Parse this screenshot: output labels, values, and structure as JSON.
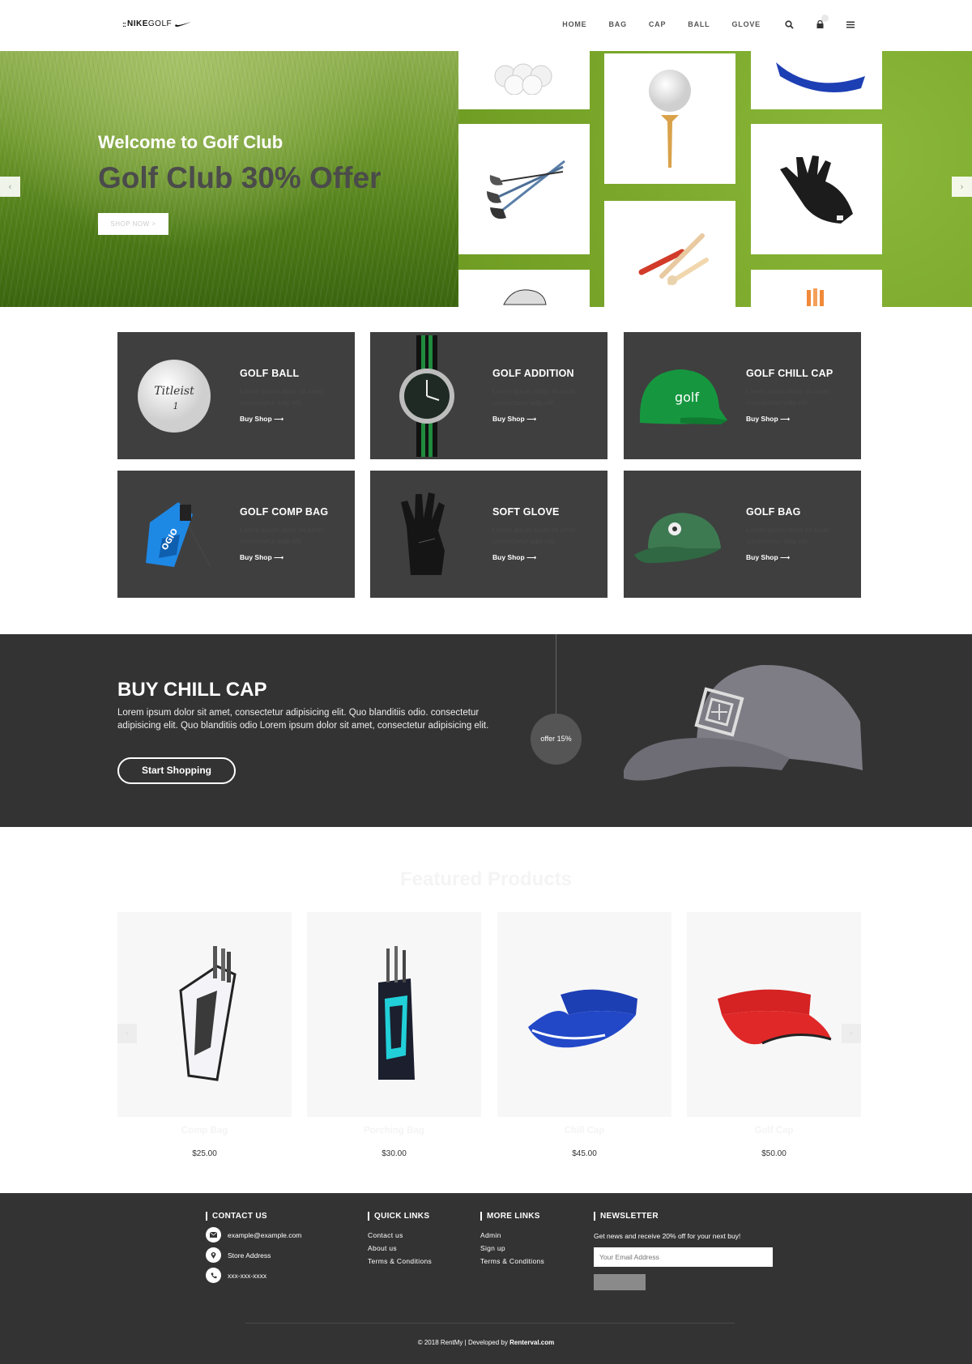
{
  "header": {
    "logo_prefix": "::",
    "logo_brand": "NIKE",
    "logo_suffix": "GOLF",
    "nav": [
      "HOME",
      "BAG",
      "CAP",
      "BALL",
      "GLOVE"
    ],
    "icons": [
      "search-icon",
      "cart-icon",
      "menu-icon"
    ]
  },
  "hero": {
    "subtitle": "Welcome to Golf Club",
    "title": "Golf Club 30% Offer",
    "button": "SHOP NOW  >",
    "prev_arrow": "‹",
    "next_arrow": "›"
  },
  "categories": [
    {
      "title": "GOLF BALL",
      "desc": "Lorem ipsum dolor sit amet, consectetur adip elit.",
      "link": "Buy Shop ⟶"
    },
    {
      "title": "GOLF ADDITION",
      "desc": "Lorem ipsum dolor sit amet, consectetur adip elit.",
      "link": "Buy Shop ⟶"
    },
    {
      "title": "GOLF CHILL CAP",
      "desc": "Lorem ipsum dolor sit amet, consectetur adip elit.",
      "link": "Buy Shop ⟶"
    },
    {
      "title": "GOLF COMP BAG",
      "desc": "Lorem ipsum dolor sit amet, consectetur adip elit.",
      "link": "Buy Shop ⟶"
    },
    {
      "title": "SOFT GLOVE",
      "desc": "Lorem ipsum dolor sit amet, consectetur adip elit.",
      "link": "Buy Shop ⟶"
    },
    {
      "title": "GOLF BAG",
      "desc": "Lorem ipsum dolor sit amet, consectetur adip elit.",
      "link": "Buy Shop ⟶"
    }
  ],
  "category_images": {
    "ball_text": "Titleist",
    "ball_number": "1",
    "cap_text": "golf",
    "bag_text": "OGIO"
  },
  "promo": {
    "title": "BUY CHILL CAP",
    "text": "Lorem ipsum dolor sit amet, consectetur adipisicing elit. Quo blanditiis odio. consectetur adipisicing elit. Quo blanditiis odio Lorem ipsum dolor sit amet, consectetur adipisicing elit.",
    "button": "Start Shopping",
    "offer": "offer 15%"
  },
  "featured": {
    "title": "Featured Products",
    "products": [
      {
        "name": "Comp Bag",
        "price": "$25.00"
      },
      {
        "name": "Porching Bag",
        "price": "$30.00"
      },
      {
        "name": "Chill Cap",
        "price": "$45.00"
      },
      {
        "name": "Golf Cap",
        "price": "$50.00"
      }
    ],
    "prev_arrow": "‹",
    "next_arrow": "›"
  },
  "footer": {
    "contact_title": "CONTACT US",
    "contact": [
      {
        "icon": "envelope-icon",
        "text": "example@example.com"
      },
      {
        "icon": "map-pin-icon",
        "text": "Store Address"
      },
      {
        "icon": "phone-icon",
        "text": "xxx-xxx-xxxx"
      }
    ],
    "quick_title": "QUICK LINKS",
    "quick_links": [
      "Contact us",
      "About us",
      "Terms & Conditions"
    ],
    "more_title": "MORE LINKS",
    "more_links": [
      "Admin",
      "Sign up",
      "Terms & Conditions"
    ],
    "newsletter_title": "NEWSLETTER",
    "newsletter_text": "Get news and receive 20% off for your next buy!",
    "email_placeholder": "Your Email Address",
    "copyright_prefix": "© 2018 RentMy | Developed by",
    "copyright_brand": "Renterval.com"
  },
  "colors": {
    "dark": "#333333",
    "tile": "#3f3f3f",
    "grass": "#6f9a2e",
    "field": "#7fab2c",
    "card_bg": "#f7f7f7"
  }
}
